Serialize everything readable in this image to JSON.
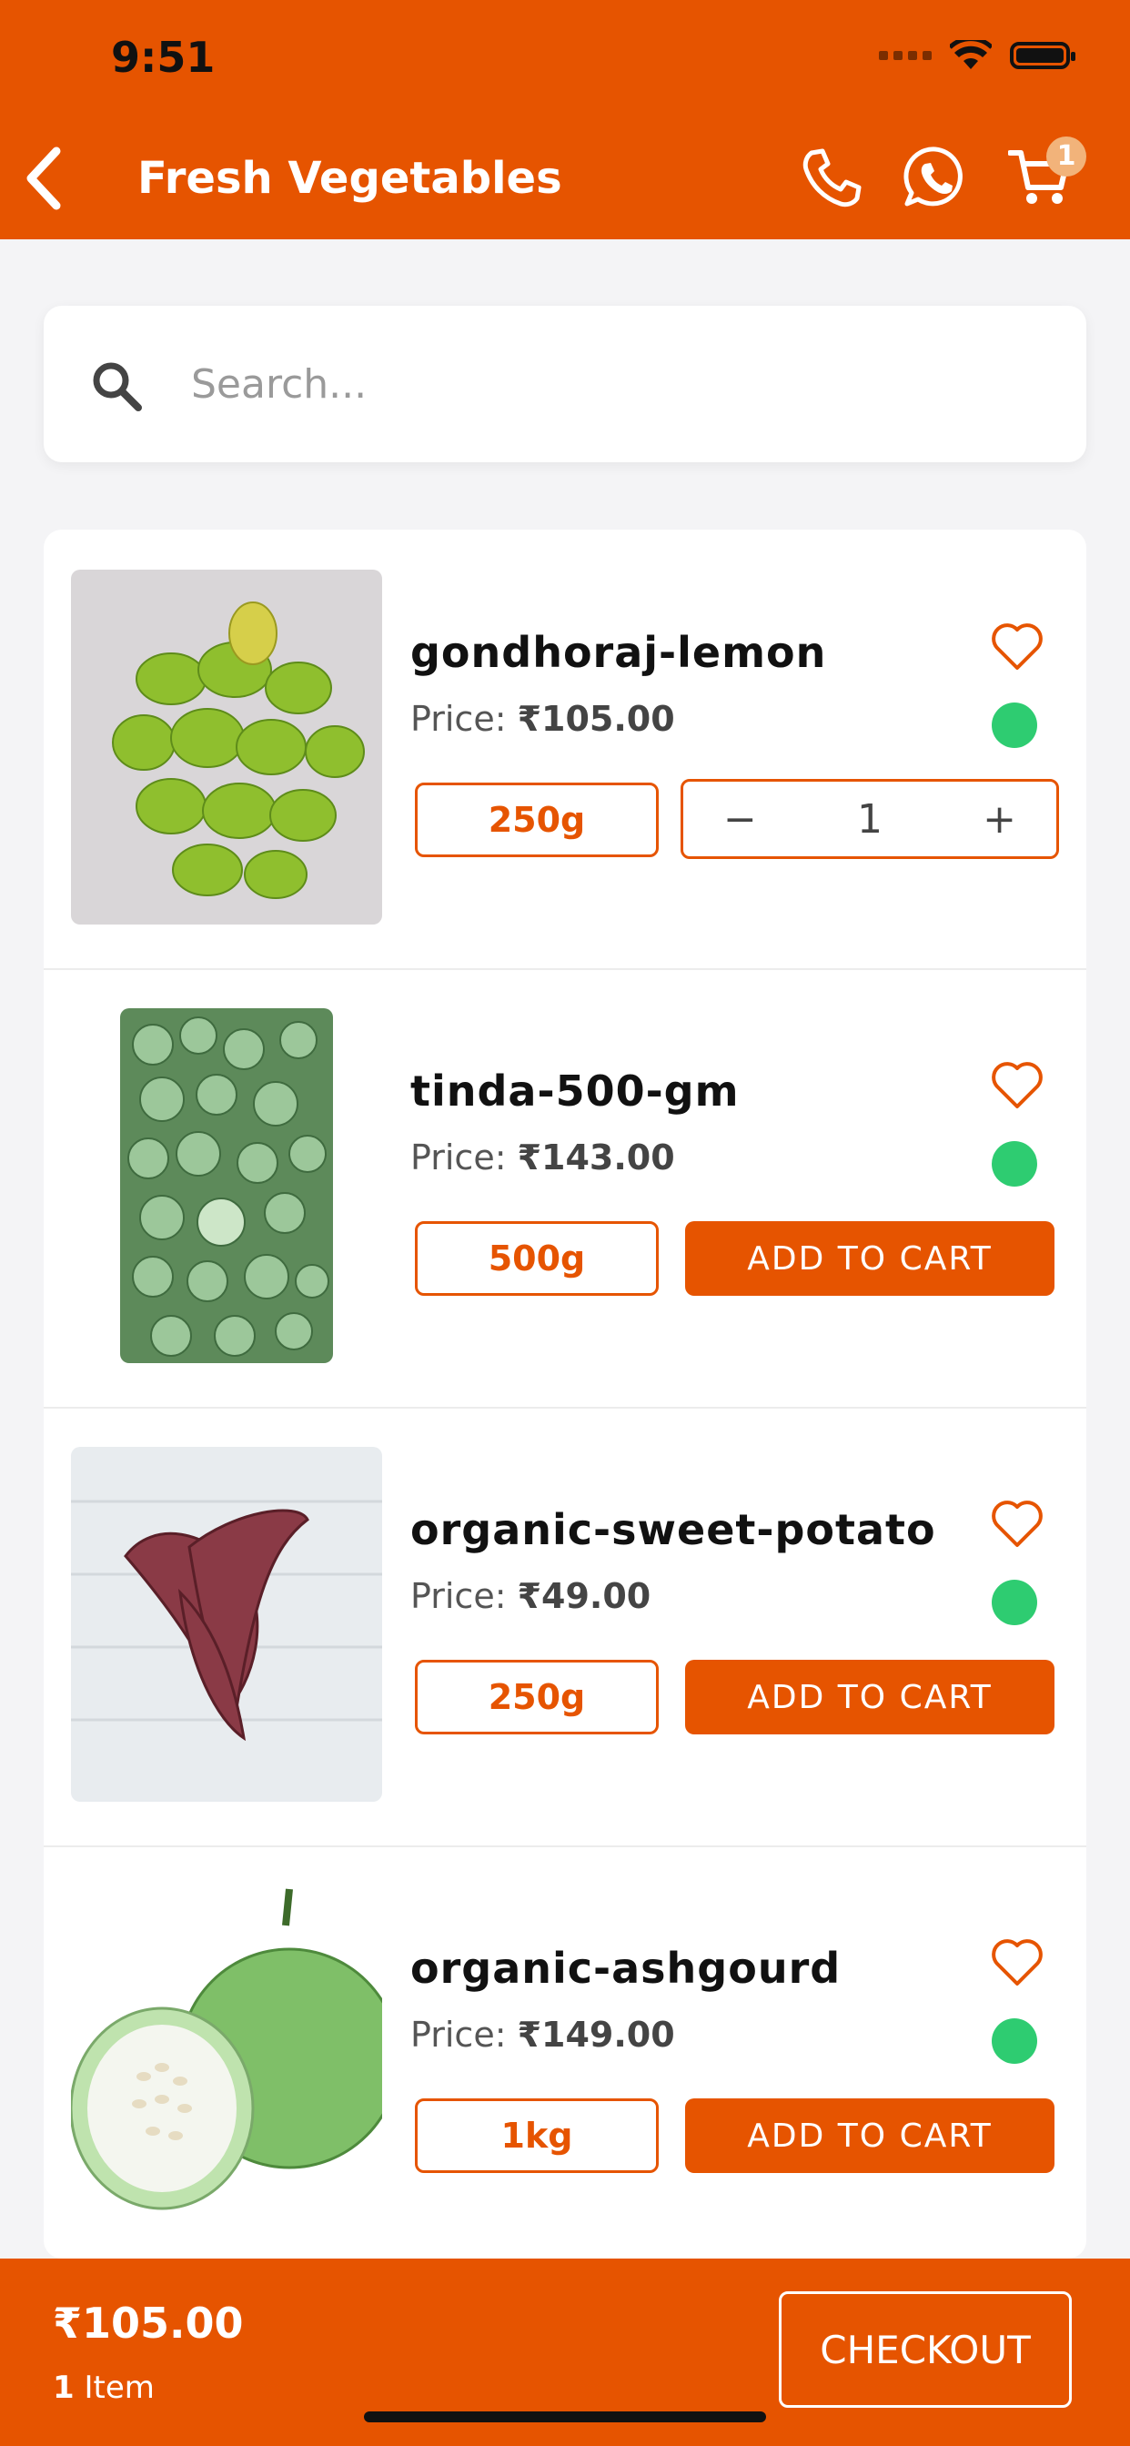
{
  "status_bar": {
    "time": "9:51"
  },
  "header": {
    "title": "Fresh Vegetables",
    "cart_count": "1",
    "icons": [
      "back-icon",
      "phone-icon",
      "whatsapp-icon",
      "cart-icon"
    ]
  },
  "search": {
    "placeholder": "Search..."
  },
  "products": [
    {
      "name": "gondhoraj-lemon",
      "price_label": "Price: ",
      "price": "₹105.00",
      "weight": "250g",
      "in_cart": true,
      "quantity": "1",
      "image": "green-lemons"
    },
    {
      "name": "tinda-500-gm",
      "price_label": "Price: ",
      "price": "₹143.00",
      "weight": "500g",
      "in_cart": false,
      "add_label": "ADD TO CART",
      "image": "tinda-gourds"
    },
    {
      "name": "organic-sweet-potato",
      "price_label": "Price: ",
      "price": "₹49.00",
      "weight": "250g",
      "in_cart": false,
      "add_label": "ADD TO CART",
      "image": "sweet-potatoes"
    },
    {
      "name": "organic-ashgourd",
      "price_label": "Price: ",
      "price": "₹149.00",
      "weight": "1kg",
      "in_cart": false,
      "add_label": "ADD TO CART",
      "image": "ash-gourd"
    }
  ],
  "stepper": {
    "minus": "−",
    "plus": "+"
  },
  "footer": {
    "total": "₹105.00",
    "item_count": "1",
    "item_label": " Item",
    "checkout_label": "CHECKOUT"
  },
  "colors": {
    "accent": "#e65400",
    "available": "#2ecc71"
  }
}
